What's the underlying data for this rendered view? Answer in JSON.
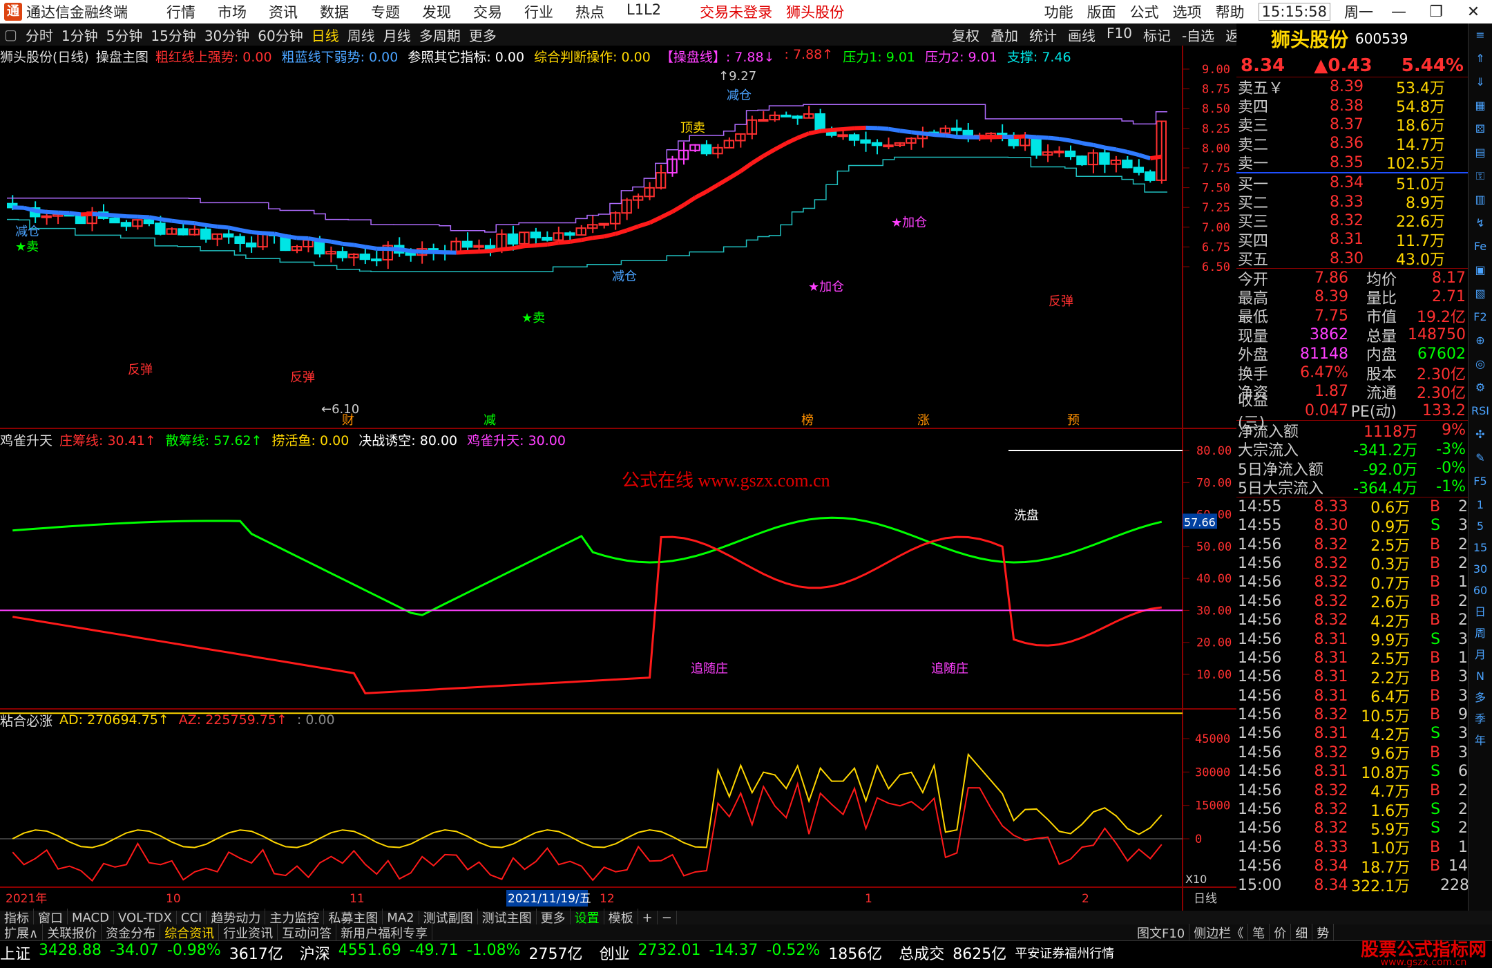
{
  "app": {
    "title": "通达信金融终端",
    "menu": [
      "行情",
      "市场",
      "资讯",
      "数据",
      "专题",
      "发现",
      "交易",
      "行业",
      "热点",
      "L1L2"
    ],
    "notice": "交易未登录",
    "stock": "狮头股份",
    "right_menu": [
      "功能",
      "版面",
      "公式",
      "选项",
      "帮助"
    ],
    "time": "15:15:58",
    "weekday": "周一"
  },
  "periods": [
    "分时",
    "1分钟",
    "5分钟",
    "15分钟",
    "30分钟",
    "60分钟",
    "日线",
    "周线",
    "月线",
    "多周期",
    "更多"
  ],
  "period_active": "日线",
  "tools": [
    "复权",
    "叠加",
    "统计",
    "画线",
    "F10",
    "标记",
    "-自选",
    "返回"
  ],
  "main_panel": {
    "name": "狮头股份(日线)",
    "formula": "操盘主图",
    "items": [
      {
        "t": "粗红线上强势: 0.00",
        "c": "#ff3030"
      },
      {
        "t": "粗蓝线下弱势: 0.00",
        "c": "#4aa3ff"
      },
      {
        "t": "参照其它指标: 0.00",
        "c": "#ffffff"
      },
      {
        "t": "综合判断操作: 0.00",
        "c": "#ffd700"
      },
      {
        "t": "【操盘线】: 7.88↓",
        "c": "#ff40ff"
      },
      {
        "t": ": 7.88↑",
        "c": "#ff3030"
      },
      {
        "t": "压力1: 9.01",
        "c": "#00ff00"
      },
      {
        "t": "压力2: 9.01",
        "c": "#ff40ff"
      },
      {
        "t": "支撑: 7.46",
        "c": "#00e5e5"
      }
    ],
    "y_ticks": [
      "9.00",
      "8.75",
      "8.50",
      "8.25",
      "8.00",
      "7.75",
      "7.50",
      "7.25",
      "7.00",
      "6.75",
      "6.50"
    ],
    "annotations": {
      "high": "9.27",
      "low": "6.10",
      "jiancang": "减仓",
      "dingmai": "顶卖",
      "mai": "★卖",
      "fantan": "反弹",
      "jiacang": "★加仓",
      "tips": [
        "财",
        "减",
        "榜",
        "涨",
        "预"
      ]
    }
  },
  "panel2": {
    "name": "鸡雀升天",
    "items": [
      {
        "t": "庄筹线: 30.41↑",
        "c": "#ff3030"
      },
      {
        "t": "散筹线: 57.62↑",
        "c": "#00ff00"
      },
      {
        "t": "捞活鱼: 0.00",
        "c": "#ffd700"
      },
      {
        "t": "决战诱空: 80.00",
        "c": "#ffffff"
      },
      {
        "t": "鸡雀升天: 30.00",
        "c": "#ff40ff"
      }
    ],
    "y_ticks": [
      "80.00",
      "70.00",
      "60.00",
      "50.00",
      "40.00",
      "30.00",
      "20.00",
      "10.00"
    ],
    "cur": "57.66",
    "watermark": "公式在线  www.gszx.com.cn",
    "labels": {
      "xianpan": "洗盘",
      "gensui": "追随庄"
    }
  },
  "panel3": {
    "name": "粘合必涨",
    "items": [
      {
        "t": "AD: 270694.75↑",
        "c": "#ffd700"
      },
      {
        "t": "AZ: 225759.75↑",
        "c": "#ff3030"
      },
      {
        "t": ": 0.00",
        "c": "#888888"
      }
    ],
    "y_ticks": [
      "45000",
      "30000",
      "15000",
      "0"
    ],
    "x10": "X10"
  },
  "xaxis": {
    "labels": [
      "2021年",
      "10",
      "11",
      "2021/11/19/五",
      "12",
      "1",
      "2"
    ],
    "period": "日线"
  },
  "quote": {
    "name": "狮头股份",
    "code": "600539",
    "price": "8.34",
    "change": "▲0.43",
    "pct": "5.44%",
    "asks": [
      [
        "卖五￥",
        "8.39",
        "53.4万"
      ],
      [
        "卖四",
        "8.38",
        "54.8万"
      ],
      [
        "卖三",
        "8.37",
        "18.6万"
      ],
      [
        "卖二",
        "8.36",
        "14.7万"
      ],
      [
        "卖一",
        "8.35",
        "102.5万"
      ]
    ],
    "bids": [
      [
        "买一",
        "8.34",
        "51.0万"
      ],
      [
        "买二",
        "8.33",
        "8.9万"
      ],
      [
        "买三",
        "8.32",
        "22.6万"
      ],
      [
        "买四",
        "8.31",
        "11.7万"
      ],
      [
        "买五",
        "8.30",
        "43.0万"
      ]
    ],
    "stats": [
      [
        "今开",
        "7.86",
        "均价",
        "8.17"
      ],
      [
        "最高",
        "8.39",
        "量比",
        "2.71"
      ],
      [
        "最低",
        "7.75",
        "市值",
        "19.2亿"
      ],
      [
        "现量",
        "3862",
        "总量",
        "148750"
      ],
      [
        "外盘",
        "81148",
        "内盘",
        "67602"
      ],
      [
        "换手",
        "6.47%",
        "股本",
        "2.30亿"
      ],
      [
        "净资",
        "1.87",
        "流通",
        "2.30亿"
      ],
      [
        "收益(三)",
        "0.047",
        "PE(动)",
        "133.2"
      ]
    ],
    "flows": [
      [
        "净流入额",
        "1118万",
        "9%"
      ],
      [
        "大宗流入",
        "-341.2万",
        "-3%"
      ],
      [
        "5日净流入额",
        "-92.0万",
        "-0%"
      ],
      [
        "5日大宗流入",
        "-364.4万",
        "-1%"
      ]
    ],
    "ticks": [
      [
        "14:55",
        "8.33",
        "0.6万",
        "B",
        "2"
      ],
      [
        "14:55",
        "8.30",
        "0.9万",
        "S",
        "3"
      ],
      [
        "14:56",
        "8.32",
        "2.5万",
        "B",
        "2"
      ],
      [
        "14:56",
        "8.32",
        "0.3万",
        "B",
        "2"
      ],
      [
        "14:56",
        "8.32",
        "0.7万",
        "B",
        "1"
      ],
      [
        "14:56",
        "8.32",
        "2.6万",
        "B",
        "2"
      ],
      [
        "14:56",
        "8.32",
        "4.2万",
        "B",
        "2"
      ],
      [
        "14:56",
        "8.31",
        "9.9万",
        "S",
        "3"
      ],
      [
        "14:56",
        "8.31",
        "2.5万",
        "B",
        "1"
      ],
      [
        "14:56",
        "8.31",
        "2.2万",
        "B",
        "3"
      ],
      [
        "14:56",
        "8.31",
        "6.4万",
        "B",
        "3"
      ],
      [
        "14:56",
        "8.32",
        "10.5万",
        "B",
        "9"
      ],
      [
        "14:56",
        "8.31",
        "4.2万",
        "S",
        "3"
      ],
      [
        "14:56",
        "8.32",
        "9.6万",
        "B",
        "3"
      ],
      [
        "14:56",
        "8.31",
        "10.8万",
        "S",
        "6"
      ],
      [
        "14:56",
        "8.32",
        "4.7万",
        "B",
        "2"
      ],
      [
        "14:56",
        "8.32",
        "1.6万",
        "S",
        "2"
      ],
      [
        "14:56",
        "8.32",
        "5.9万",
        "S",
        "2"
      ],
      [
        "14:56",
        "8.33",
        "1.0万",
        "B",
        "1"
      ],
      [
        "14:56",
        "8.34",
        "18.7万",
        "B",
        "14"
      ],
      [
        "15:00",
        "8.34",
        "322.1万",
        "",
        "228"
      ]
    ]
  },
  "bottom1": [
    "指标",
    "窗口",
    "MACD",
    "VOL-TDX",
    "CCI",
    "趋势动力",
    "主力监控",
    "私募主图",
    "MA2",
    "测试副图",
    "测试主图",
    "更多",
    "设置",
    "模板",
    "+",
    "−"
  ],
  "bottom2": [
    "扩展∧",
    "关联报价",
    "资金分布",
    "综合资讯",
    "行业资讯",
    "互动问答",
    "新用户福利专享"
  ],
  "bottom2_right": [
    "图文F10",
    "侧边栏《",
    "笔",
    "价",
    "细",
    "势"
  ],
  "status": {
    "items": [
      {
        "n": "上证",
        "v": "3428.88",
        "d": "-34.07",
        "p": "-0.98%",
        "a": "3617亿"
      },
      {
        "n": "沪深",
        "v": "4551.69",
        "d": "-49.71",
        "p": "-1.08%",
        "a": "2757亿"
      },
      {
        "n": "创业",
        "v": "2732.01",
        "d": "-14.37",
        "p": "-0.52%",
        "a": "1856亿"
      }
    ],
    "total_label": "总成交",
    "total": "8625亿",
    "broker": "平安证券福州行情",
    "brand": "股票公式指标网",
    "brand_url": "www.gszx.com.cn"
  },
  "sidetools": [
    "≡",
    "⇑",
    "⇓",
    "▦",
    "⚄",
    "▤",
    "⚿",
    "▥",
    "↯",
    "Fe",
    "▣",
    "▧",
    "F2",
    "⊕",
    "◎",
    "⚙",
    "RSI",
    "✣",
    "✎",
    "F5",
    "1",
    "5",
    "15",
    "30",
    "60",
    "日",
    "周",
    "月",
    "N",
    "多",
    "季",
    "年"
  ]
}
